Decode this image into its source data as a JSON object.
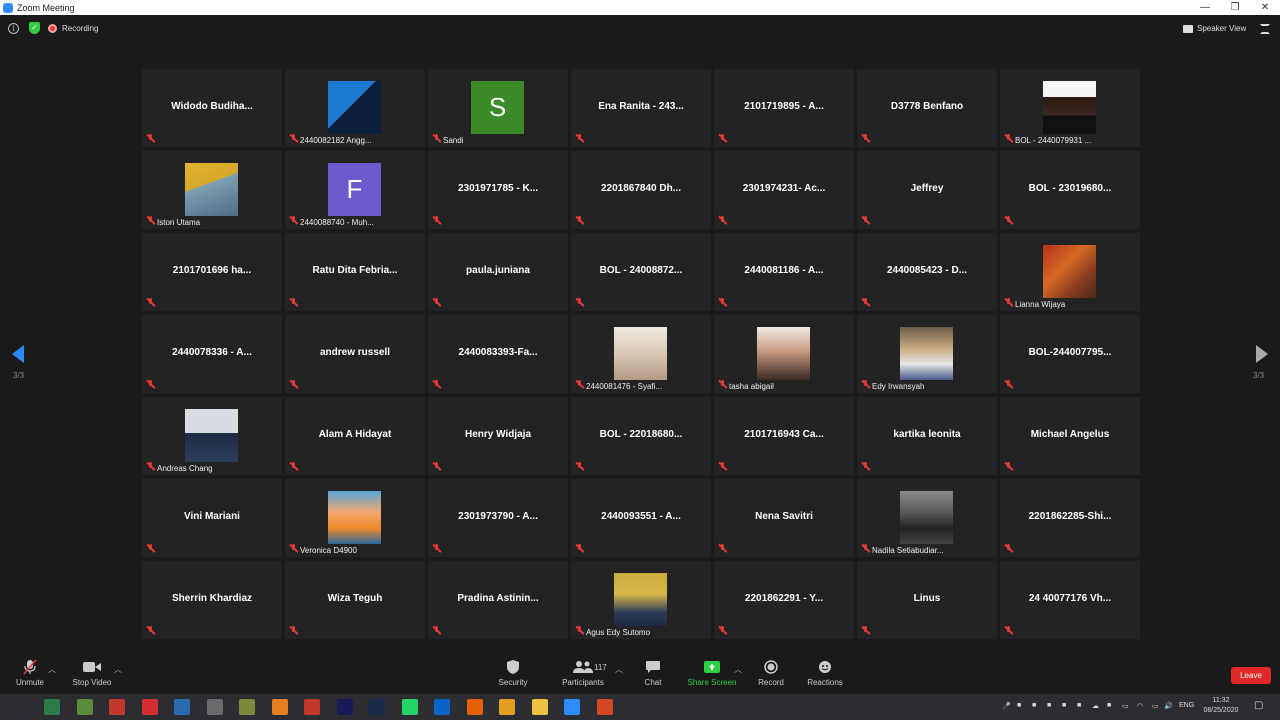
{
  "window": {
    "title": "Zoom Meeting",
    "controls": [
      "—",
      "❐",
      "✕"
    ]
  },
  "topbar": {
    "recording_label": "Recording",
    "speaker_view_label": "Speaker View"
  },
  "pagination": {
    "left": "3/3",
    "right": "3/3"
  },
  "grid": {
    "rows": [
      [
        {
          "label": "Widodo  Budiha...",
          "type": "name"
        },
        {
          "label": "2440082182 Angg...",
          "type": "photo"
        },
        {
          "label": "Sandi",
          "type": "letter",
          "letter": "S",
          "color": "#3a8a2a"
        },
        {
          "label": "Ena Ranita - 243...",
          "type": "name"
        },
        {
          "label": "2101719895 - A...",
          "type": "name"
        },
        {
          "label": "D3778 Benfano",
          "type": "name"
        },
        {
          "label": "BOL - 2440079931 ...",
          "type": "photo"
        }
      ],
      [
        {
          "label": "Iston Utama",
          "type": "photo"
        },
        {
          "label": "2440088740 - Muh...",
          "type": "letter",
          "letter": "F",
          "color": "#6a5acd"
        },
        {
          "label": "2301971785 - K...",
          "type": "name"
        },
        {
          "label": "2201867840 Dh...",
          "type": "name"
        },
        {
          "label": "2301974231- Ac...",
          "type": "name"
        },
        {
          "label": "Jeffrey",
          "type": "name"
        },
        {
          "label": "BOL - 23019680...",
          "type": "name"
        }
      ],
      [
        {
          "label": "2101701696 ha...",
          "type": "name"
        },
        {
          "label": "Ratu  Dita  Febria...",
          "type": "name"
        },
        {
          "label": "paula.juniana",
          "type": "name"
        },
        {
          "label": "BOL - 24008872...",
          "type": "name"
        },
        {
          "label": "2440081186 - A...",
          "type": "name"
        },
        {
          "label": "2440085423 - D...",
          "type": "name"
        },
        {
          "label": "Lianna Wijaya",
          "type": "photo"
        }
      ],
      [
        {
          "label": "2440078336 - A...",
          "type": "name"
        },
        {
          "label": "andrew russell",
          "type": "name"
        },
        {
          "label": "2440083393-Fa...",
          "type": "name"
        },
        {
          "label": "2440081476 - Syafi...",
          "type": "photo"
        },
        {
          "label": "tasha abigail",
          "type": "photo"
        },
        {
          "label": "Edy Irwansyah",
          "type": "photo"
        },
        {
          "label": "BOL-244007795...",
          "type": "name"
        }
      ],
      [
        {
          "label": "Andreas Chang",
          "type": "photo"
        },
        {
          "label": "Alam A Hidayat",
          "type": "name"
        },
        {
          "label": "Henry Widjaja",
          "type": "name"
        },
        {
          "label": "BOL - 22018680...",
          "type": "name"
        },
        {
          "label": "2101716943 Ca...",
          "type": "name"
        },
        {
          "label": "kartika leonita",
          "type": "name"
        },
        {
          "label": "Michael Angelus",
          "type": "name"
        }
      ],
      [
        {
          "label": "Vini Mariani",
          "type": "name"
        },
        {
          "label": "Veronica D4900",
          "type": "photo"
        },
        {
          "label": "2301973790 - A...",
          "type": "name"
        },
        {
          "label": "2440093551 - A...",
          "type": "name"
        },
        {
          "label": "Nena Savitri",
          "type": "name"
        },
        {
          "label": "Nadila Setiabudiar...",
          "type": "photo"
        },
        {
          "label": "2201862285-Shi...",
          "type": "name"
        }
      ],
      [
        {
          "label": "Sherrin Khardiaz",
          "type": "name"
        },
        {
          "label": "Wiza Teguh",
          "type": "name"
        },
        {
          "label": "Pradina  Astinin...",
          "type": "name"
        },
        {
          "label": "Agus Edy Sutomo",
          "type": "photo"
        },
        {
          "label": "2201862291 - Y...",
          "type": "name"
        },
        {
          "label": "Linus",
          "type": "name"
        },
        {
          "label": "24 40077176 Vh...",
          "type": "name"
        }
      ]
    ]
  },
  "toolbar": {
    "unmute": "Unmute",
    "stop_video": "Stop Video",
    "security": "Security",
    "participants": "Participants",
    "participants_count": "117",
    "chat": "Chat",
    "share_screen": "Share Screen",
    "record": "Record",
    "reactions": "Reactions",
    "leave": "Leave"
  },
  "taskbar": {
    "apps": [
      "edge",
      "minecraft",
      "app-red",
      "app-blue",
      "camera",
      "game",
      "settings",
      "python",
      "media-encoder",
      "premiere",
      "photoshop",
      "whatsapp",
      "outlook",
      "firefox",
      "chrome",
      "file-explorer",
      "zoom",
      "powerpoint"
    ],
    "language": "ENG",
    "time": "11:32",
    "date": "08/25/2020"
  }
}
